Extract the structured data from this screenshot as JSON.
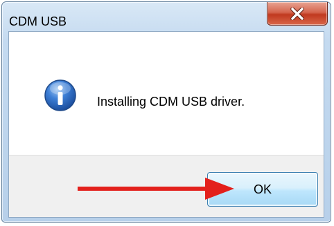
{
  "window": {
    "title": "CDM USB"
  },
  "dialog": {
    "message": "Installing CDM USB driver.",
    "ok_label": "OK"
  },
  "icons": {
    "message_icon": "information-icon",
    "close_icon": "close-icon",
    "annotation": "red-arrow-icon"
  },
  "colors": {
    "arrow": "#e3201c",
    "close_button": "#c8452e",
    "ok_border": "#3c7fb1"
  }
}
